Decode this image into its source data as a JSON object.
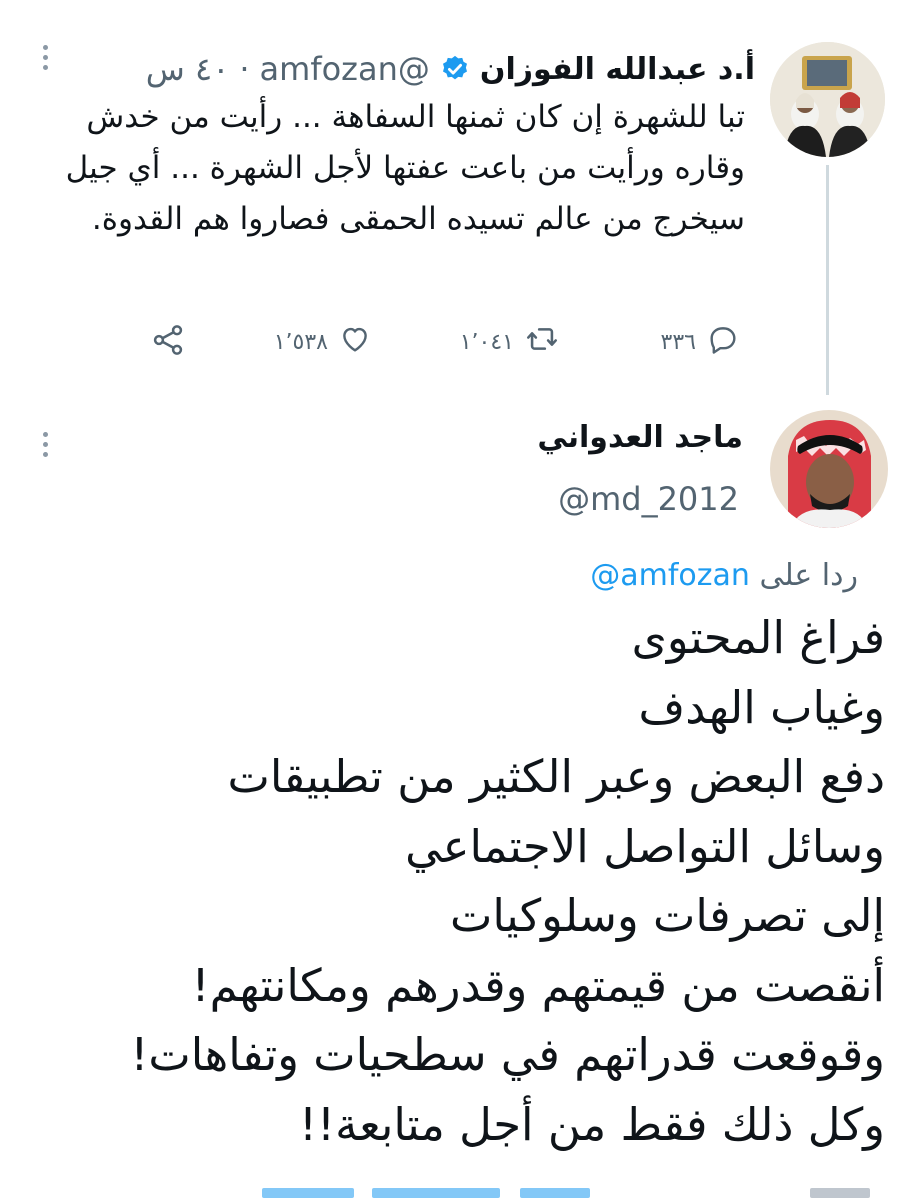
{
  "tweet1": {
    "display_name": "أ.د عبدالله الفوزان",
    "handle": "@amfozan",
    "time": "٤٠ س",
    "text": "تبا للشهرة إن كان ثمنها السفاهة ... رأيت من خدش وقاره ورأيت من باعت عفتها لأجل الشهرة ... أي جيل سيخرج من عالم تسيده الحمقى فصاروا هم القدوة.",
    "replies": "٣٣٦",
    "retweets": "١٬٠٤١",
    "likes": "١٬٥٣٨"
  },
  "tweet2": {
    "display_name": "ماجد العدواني",
    "handle": "@md_2012",
    "reply_prefix": "ردا على",
    "reply_mention": "@amfozan",
    "text": "فراغ المحتوى\nوغياب الهدف\nدفع البعض وعبر الكثير من تطبيقات\nوسائل التواصل الاجتماعي\nإلى تصرفات وسلوكيات\nأنقصت من قيمتهم وقدرهم ومكانتهم!\nوقوقعت قدراتهم في سطحيات وتفاهات!\nوكل ذلك فقط من أجل متابعة!!"
  },
  "colors": {
    "accent": "#1d9bf0",
    "secondary_text": "#536471",
    "thread_line": "#cfd9de"
  },
  "icons": {
    "more": "more-vertical-icon",
    "verified": "verified-badge-icon",
    "reply": "reply-icon",
    "retweet": "retweet-icon",
    "like": "heart-icon",
    "share": "share-icon"
  }
}
